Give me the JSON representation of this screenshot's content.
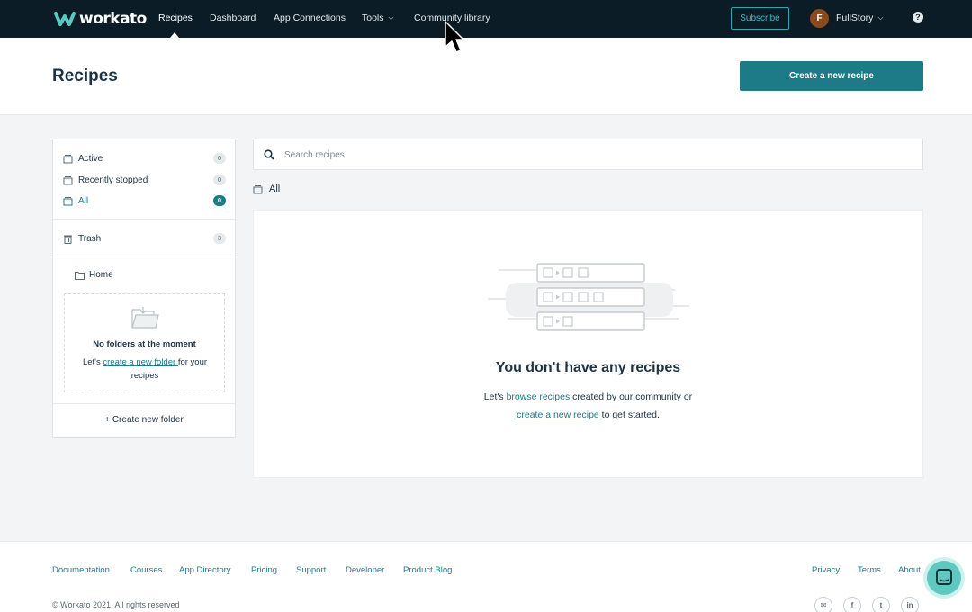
{
  "nav": {
    "brand": "workato",
    "items": [
      "Recipes",
      "Dashboard",
      "App Connections",
      "Tools",
      "Community library"
    ],
    "subscribe": "Subscribe",
    "avatar_initial": "F",
    "account": "FullStory",
    "help": "?"
  },
  "header": {
    "title": "Recipes",
    "create_button": "Create a new recipe"
  },
  "sidebar": {
    "filters": [
      {
        "label": "Active",
        "count": "0"
      },
      {
        "label": "Recently stopped",
        "count": "0"
      },
      {
        "label": "All",
        "count": "0"
      }
    ],
    "trash": {
      "label": "Trash",
      "count": "3"
    },
    "home": "Home",
    "empty_title": "No folders at the moment",
    "empty_prefix": "Let's ",
    "empty_link": "create a new folder ",
    "empty_suffix": "for your recipes",
    "create_folder": "+ Create new folder"
  },
  "search": {
    "placeholder": "Search recipes"
  },
  "breadcrumb": "All",
  "empty_state": {
    "title": "You don't have any recipes",
    "line1_prefix": "Let's ",
    "line1_link": "browse recipes",
    "line1_suffix": " created by our community or",
    "line2_link": "create a new recipe",
    "line2_suffix": " to get started."
  },
  "footer": {
    "links": [
      "Documentation",
      "Courses",
      "App Directory",
      "Pricing",
      "Support",
      "Developer",
      "Product Blog"
    ],
    "right_links": [
      "Privacy",
      "Terms",
      "About"
    ],
    "copyright": "© Workato 2021. All rights reserved",
    "social": [
      "mail-icon",
      "facebook-icon",
      "twitter-icon",
      "linkedin-icon"
    ]
  },
  "colors": {
    "nav_bg": "#0b1c26",
    "accent": "#1c7b86",
    "subscribe": "#25aab3"
  }
}
